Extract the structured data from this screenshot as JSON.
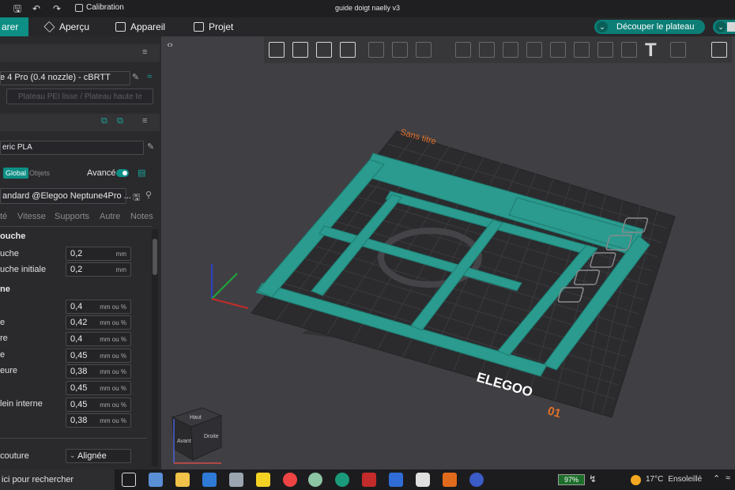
{
  "titlebar": {
    "calibration_label": "Calibration",
    "document_title": "guide doigt naelly v3"
  },
  "menubar": {
    "prepare_label": "arer",
    "preview_label": "Aperçu",
    "device_label": "Appareil",
    "project_label": "Projet",
    "slice_label": "Découper le plateau"
  },
  "sidebar": {
    "printer_name": "e 4 Pro (0.4 nozzle) - cBRTT",
    "plate_type": "Plateau PEI lisse / Plateau haute te",
    "filament": "eric PLA",
    "scope_global": "Global",
    "scope_objects": "Objets",
    "advanced_label": "Avancé",
    "process_profile": "andard @Elegoo Neptune4Pro ...",
    "tabs": [
      "té",
      "Vitesse",
      "Supports",
      "Autre",
      "Notes"
    ],
    "section_layer": "ouche",
    "section_width": "ne",
    "params_layer": [
      {
        "label": "uche",
        "value": "0,2",
        "unit": "mm"
      },
      {
        "label": "uche initiale",
        "value": "0,2",
        "unit": "mm"
      }
    ],
    "params_width": [
      {
        "label": "",
        "value": "0,4",
        "unit": "mm ou %"
      },
      {
        "label": "e",
        "value": "0,42",
        "unit": "mm ou %"
      },
      {
        "label": "re",
        "value": "0,4",
        "unit": "mm ou %"
      },
      {
        "label": "e",
        "value": "0,45",
        "unit": "mm ou %"
      },
      {
        "label": "eure",
        "value": "0,38",
        "unit": "mm ou %"
      },
      {
        "label": "",
        "value": "0,45",
        "unit": "mm ou %"
      },
      {
        "label": "lein interne",
        "value": "0,45",
        "unit": "mm ou %"
      },
      {
        "label": "",
        "value": "0,38",
        "unit": "mm ou %"
      }
    ],
    "seam_label": "couture",
    "seam_value": "Alignée"
  },
  "viewport": {
    "plate_name": "Sans titre",
    "plate_number": "01",
    "brand_logo": "ELEGOO",
    "viewcube_top": "Haut",
    "viewcube_front": "Avant",
    "viewcube_right": "Droite"
  },
  "taskbar": {
    "search_text": "ici pour rechercher",
    "battery": "97%",
    "temperature": "17°C",
    "weather": "Ensoleillé"
  },
  "colors": {
    "accent": "#0d8f85",
    "model": "#2a9b8e",
    "bed": "#2b2b2e"
  }
}
